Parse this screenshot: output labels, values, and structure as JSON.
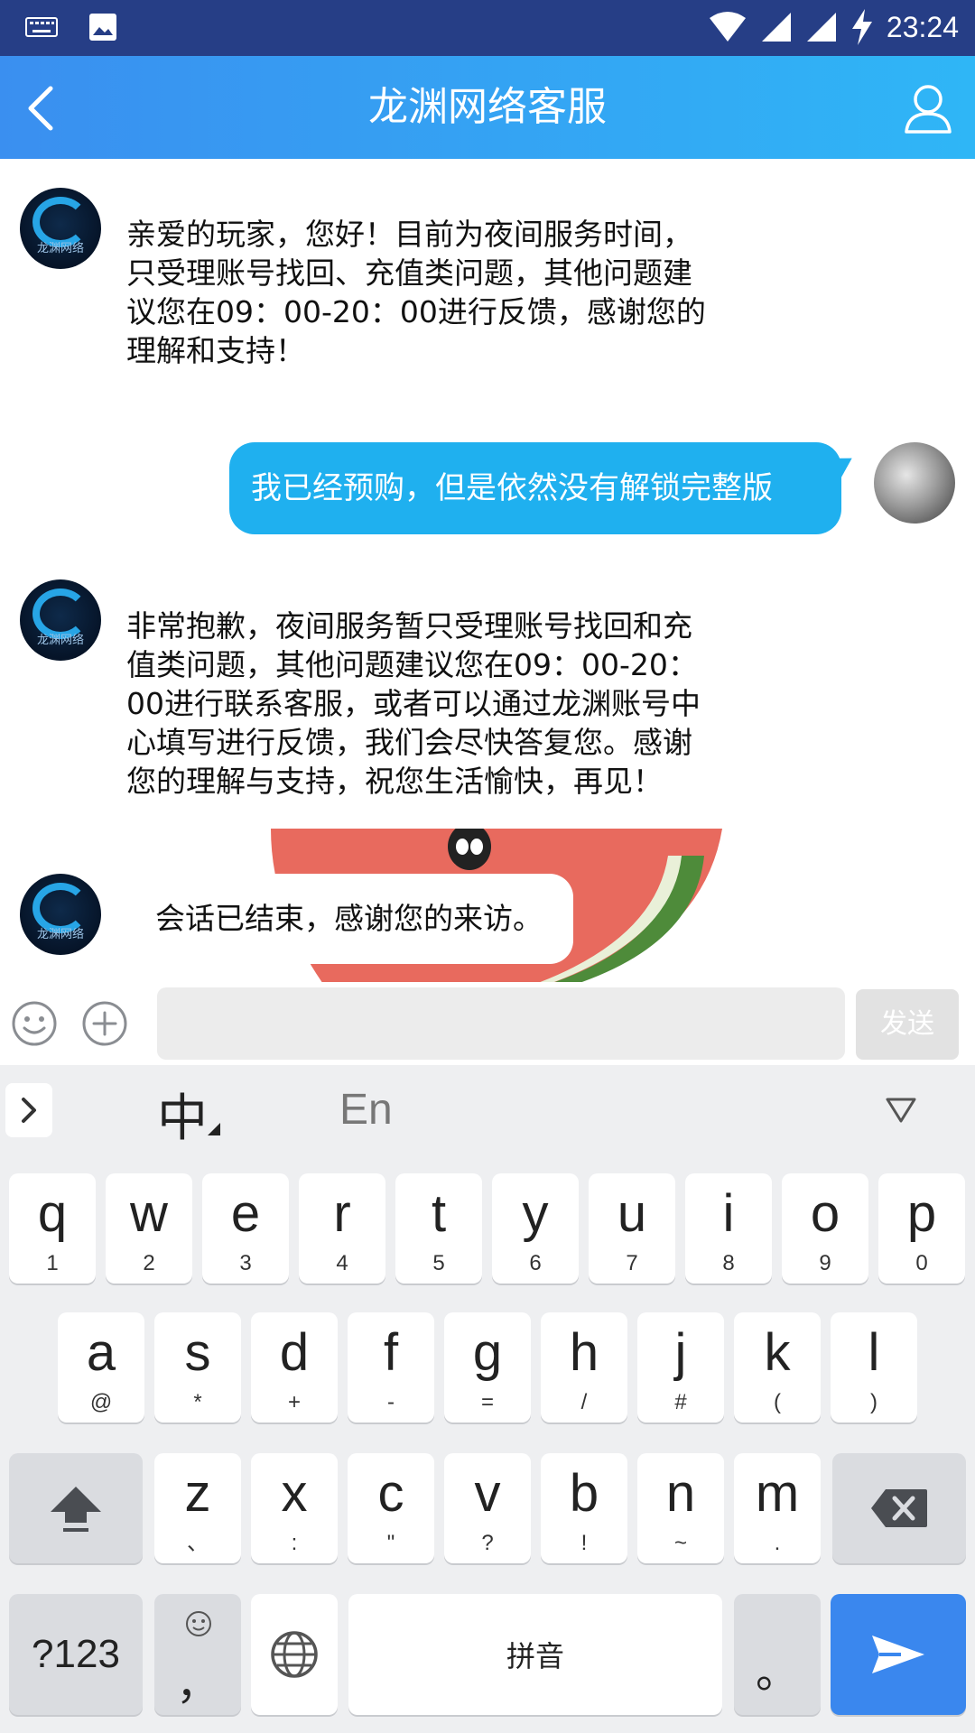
{
  "status_bar": {
    "time": "23:24",
    "icons": [
      "keyboard-icon",
      "image-icon",
      "wifi-icon",
      "signal-icon",
      "signal-icon",
      "charging-icon"
    ]
  },
  "header": {
    "title": "龙渊网络客服",
    "back_icon": "chevron-left-icon",
    "profile_icon": "person-icon"
  },
  "messages": [
    {
      "sender": "agent",
      "text_lines": [
        "亲爱的玩家，您好！目前为夜间服务时间，",
        "只受理账号找回、充值类问题，其他问题建",
        "议您在09：00-20：00进行反馈，感谢您的",
        "理解和支持！"
      ]
    },
    {
      "sender": "user",
      "text": "我已经预购，但是依然没有解锁完整版"
    },
    {
      "sender": "agent",
      "text_lines": [
        "非常抱歉，夜间服务暂只受理账号找回和充",
        "值类问题，其他问题建议您在09：00-20：",
        "00进行联系客服，或者可以通过龙渊账号中",
        "心填写进行反馈，我们会尽快答复您。感谢",
        "您的理解与支持，祝您生活愉快，再见！"
      ]
    },
    {
      "sender": "agent",
      "text": "会话已结束，感谢您的来访。"
    }
  ],
  "agent_avatar_text": "龙渊网络",
  "input_bar": {
    "placeholder": "",
    "send_label": "发送"
  },
  "keyboard": {
    "mode_chinese": "中",
    "mode_english": "En",
    "row1": [
      {
        "main": "q",
        "sub": "1"
      },
      {
        "main": "w",
        "sub": "2"
      },
      {
        "main": "e",
        "sub": "3"
      },
      {
        "main": "r",
        "sub": "4"
      },
      {
        "main": "t",
        "sub": "5"
      },
      {
        "main": "y",
        "sub": "6"
      },
      {
        "main": "u",
        "sub": "7"
      },
      {
        "main": "i",
        "sub": "8"
      },
      {
        "main": "o",
        "sub": "9"
      },
      {
        "main": "p",
        "sub": "0"
      }
    ],
    "row2": [
      {
        "main": "a",
        "sub": "@"
      },
      {
        "main": "s",
        "sub": "*"
      },
      {
        "main": "d",
        "sub": "+"
      },
      {
        "main": "f",
        "sub": "-"
      },
      {
        "main": "g",
        "sub": "="
      },
      {
        "main": "h",
        "sub": "/"
      },
      {
        "main": "j",
        "sub": "#"
      },
      {
        "main": "k",
        "sub": "("
      },
      {
        "main": "l",
        "sub": ")"
      }
    ],
    "row3": [
      {
        "main": "z",
        "sub": "、"
      },
      {
        "main": "x",
        "sub": ":"
      },
      {
        "main": "c",
        "sub": "\""
      },
      {
        "main": "v",
        "sub": "?"
      },
      {
        "main": "b",
        "sub": "!"
      },
      {
        "main": "n",
        "sub": "~"
      },
      {
        "main": "m",
        "sub": "."
      }
    ],
    "symbols_label": "?123",
    "comma_label": "，",
    "space_label": "拼音",
    "period_label": "。"
  },
  "colors": {
    "status_bar": "#263e86",
    "header_start": "#3a8ff0",
    "header_end": "#2fb6f6",
    "user_bubble": "#1fb0ef",
    "enter_key": "#3a87ee"
  }
}
